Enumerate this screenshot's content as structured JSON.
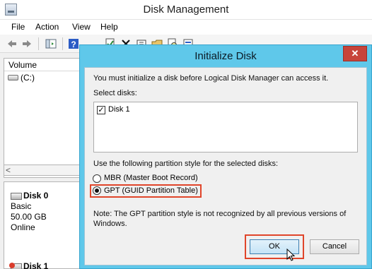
{
  "window": {
    "title": "Disk Management"
  },
  "menu": [
    "File",
    "Action",
    "View",
    "Help"
  ],
  "icons": {
    "back": "back-arrow-icon",
    "forward": "forward-arrow-icon",
    "console": "console-tree-icon",
    "help": "help-icon",
    "properties": "properties-icon",
    "delete": "delete-icon",
    "open": "open-icon",
    "explore": "explore-icon",
    "zoom": "magnifier-icon",
    "extra": "more-icon"
  },
  "volume_list": {
    "header": "Volume",
    "items": [
      "(C:)"
    ],
    "scroll_left": "<"
  },
  "disks": [
    {
      "name": "Disk 0",
      "type": "Basic",
      "size": "50.00 GB",
      "status": "Online"
    },
    {
      "name": "Disk 1"
    }
  ],
  "dialog": {
    "title": "Initialize Disk",
    "close_glyph": "✕",
    "intro": "You must initialize a disk before Logical Disk Manager can access it.",
    "select_label": "Select disks:",
    "disk_items": [
      {
        "label": "Disk 1",
        "checked": true
      }
    ],
    "style_label": "Use the following partition style for the selected disks:",
    "options": [
      {
        "label": "MBR (Master Boot Record)",
        "selected": false
      },
      {
        "label": "GPT (GUID Partition Table)",
        "selected": true
      }
    ],
    "note_line1": "Note: The GPT partition style is not recognized by all previous versions of",
    "note_line2": "Windows.",
    "ok_label": "OK",
    "cancel_label": "Cancel",
    "check_glyph": "✓"
  },
  "colors": {
    "highlight": "#e0452a",
    "dialog_frame": "#5fc8ea",
    "close_button": "#c7443a"
  }
}
